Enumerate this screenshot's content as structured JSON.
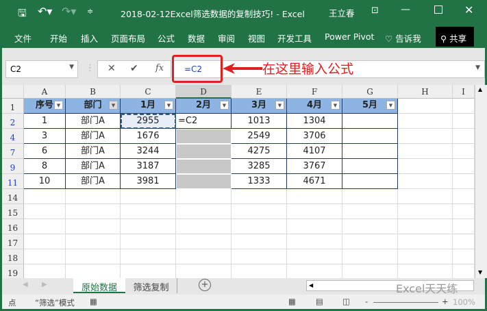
{
  "title": {
    "text": "2018-02-12Excel筛选数据的复制技巧! - Excel",
    "user": "王立春",
    "icons": [
      "save-icon",
      "undo-icon",
      "redo-icon",
      "customize-icon",
      "ribbon-display-icon",
      "minimize-icon",
      "maximize-icon",
      "close-icon"
    ]
  },
  "ribbon": {
    "tabs": [
      "文件",
      "开始",
      "插入",
      "页面布局",
      "公式",
      "数据",
      "审阅",
      "视图",
      "开发工具",
      "Power Pivot"
    ],
    "tell_me": "告诉我",
    "share": "共享"
  },
  "formula_bar": {
    "name_box": "C2",
    "formula": "=C2",
    "annotation": "在这里输入公式",
    "annotation_color": "#e02020"
  },
  "columns": [
    "A",
    "B",
    "C",
    "D",
    "E",
    "F",
    "G",
    "H",
    "I"
  ],
  "header_row": {
    "row": "1",
    "cells": [
      "序号",
      "部门",
      "1月",
      "2月",
      "3月",
      "4月",
      "5月"
    ]
  },
  "rows": [
    {
      "row": "2",
      "cells": [
        "1",
        "部门A",
        "2955",
        "=C2",
        "1013",
        "1304",
        ""
      ]
    },
    {
      "row": "4",
      "cells": [
        "3",
        "部门A",
        "1676",
        "",
        "2549",
        "3706",
        ""
      ]
    },
    {
      "row": "7",
      "cells": [
        "6",
        "部门A",
        "3244",
        "",
        "4275",
        "4107",
        ""
      ]
    },
    {
      "row": "9",
      "cells": [
        "8",
        "部门A",
        "3187",
        "",
        "3285",
        "3767",
        ""
      ]
    },
    {
      "row": "11",
      "cells": [
        "10",
        "部门A",
        "3981",
        "",
        "1333",
        "4671",
        ""
      ]
    }
  ],
  "empty_rows": [
    "14",
    "15",
    "16",
    "17",
    "18",
    "19"
  ],
  "sheets": [
    {
      "name": "原始数据",
      "active": true
    },
    {
      "name": "筛选复制",
      "active": false
    }
  ],
  "watermark": "Excel天天练",
  "status": {
    "mode": "点",
    "filter_mode": "“筛选”模式",
    "zoom": "100%"
  }
}
